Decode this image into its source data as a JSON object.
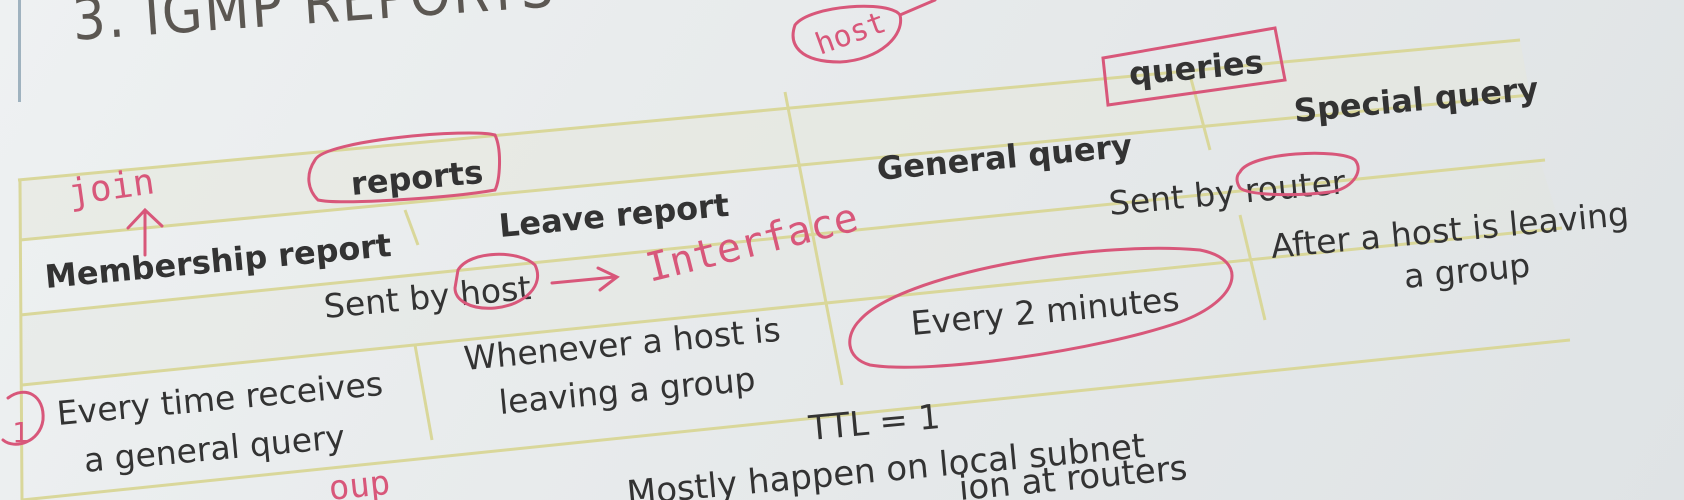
{
  "slide": {
    "title": "3. IGMP REPORTS",
    "headers": {
      "membership_report": "Membership report",
      "leave_report": "Leave report",
      "general_query": "General query",
      "special_query": "Special query"
    },
    "groups": {
      "reports": "reports",
      "queries": "queries"
    },
    "rows": {
      "sent_by_host": "Sent by host",
      "sent_by_router": "Sent by router",
      "membership_when_1": "Every time receives",
      "membership_when_2": "a general query",
      "leave_when_1": "Whenever a host is",
      "leave_when_2": "leaving a group",
      "general_when": "Every 2 minutes",
      "special_when_1": "After a host is leaving",
      "special_when_2": "a group"
    },
    "footer": {
      "ttl": "TTL = 1",
      "local": "Mostly happen on local subnet",
      "routers": "ion at routers"
    }
  },
  "annotations": {
    "join": "join",
    "interface": "Interface",
    "host": "host",
    "number": "1",
    "partial": "oup"
  },
  "colors": {
    "table_lines": "#d9d79a",
    "ink": "#d8577a",
    "text": "#333333"
  }
}
